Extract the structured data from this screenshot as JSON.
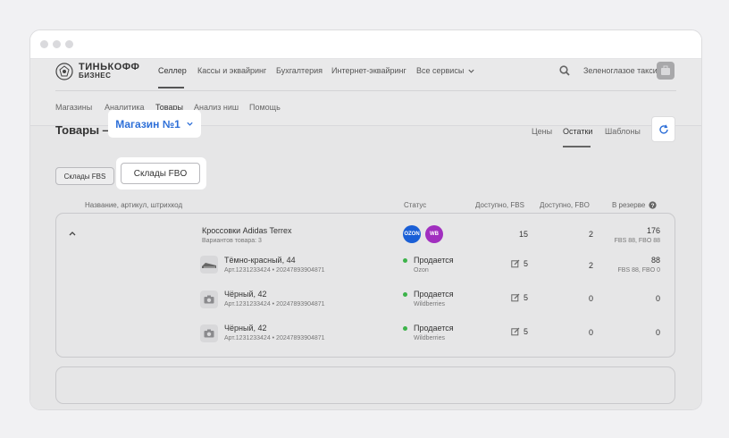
{
  "brand": {
    "line1": "ТИНЬКОФФ",
    "line2": "БИЗНЕС"
  },
  "topnav": {
    "items": [
      {
        "label": "Селлер"
      },
      {
        "label": "Кассы и эквайринг"
      },
      {
        "label": "Бухгалтерия"
      },
      {
        "label": "Интернет-эквайринг"
      },
      {
        "label": "Все сервисы"
      }
    ],
    "company": "Зеленоглазое такси"
  },
  "subnav": {
    "items": [
      {
        "label": "Магазины"
      },
      {
        "label": "Аналитика"
      },
      {
        "label": "Товары"
      },
      {
        "label": "Анализ ниш"
      },
      {
        "label": "Помощь"
      }
    ]
  },
  "page": {
    "title": "Товары —",
    "store": "Магазин №1",
    "tabs": [
      {
        "label": "Цены"
      },
      {
        "label": "Остатки"
      },
      {
        "label": "Шаблоны"
      }
    ]
  },
  "warehouses": {
    "fbs": "Склады FBS",
    "fbo": "Склады FBO"
  },
  "table": {
    "headers": [
      "Название, артикул, штрихкод",
      "Статус",
      "Доступно, FBS",
      "Доступно, FBO",
      "В резерве"
    ],
    "product": {
      "name": "Кроссовки Adidas Terrex",
      "variants_count": "Вариантов товара: 3",
      "badges": [
        {
          "label": "OZON",
          "color": "#1a5fd6"
        },
        {
          "label": "WB",
          "color": "#a12fbf"
        }
      ],
      "fbs": "15",
      "fbo": "2",
      "reserve": "176",
      "reserve_detail": "FBS 88, FBO 88"
    },
    "variants": [
      {
        "name": "Тёмно-красный, 44",
        "sku": "Арт.1231233424 • 20247893904871",
        "status": "Продается",
        "market": "Ozon",
        "fbs": "5",
        "fbo": "2",
        "reserve": "88",
        "reserve_detail": "FBS 88, FBO 0"
      },
      {
        "name": "Чёрный, 42",
        "sku": "Арт.1231233424 • 20247893904871",
        "status": "Продается",
        "market": "Wildberries",
        "fbs": "5",
        "fbo": "0",
        "reserve": "0",
        "reserve_detail": ""
      },
      {
        "name": "Чёрный, 42",
        "sku": "Арт.1231233424 • 20247893904871",
        "status": "Продается",
        "market": "Wildberries",
        "fbs": "5",
        "fbo": "0",
        "reserve": "0",
        "reserve_detail": ""
      }
    ]
  }
}
